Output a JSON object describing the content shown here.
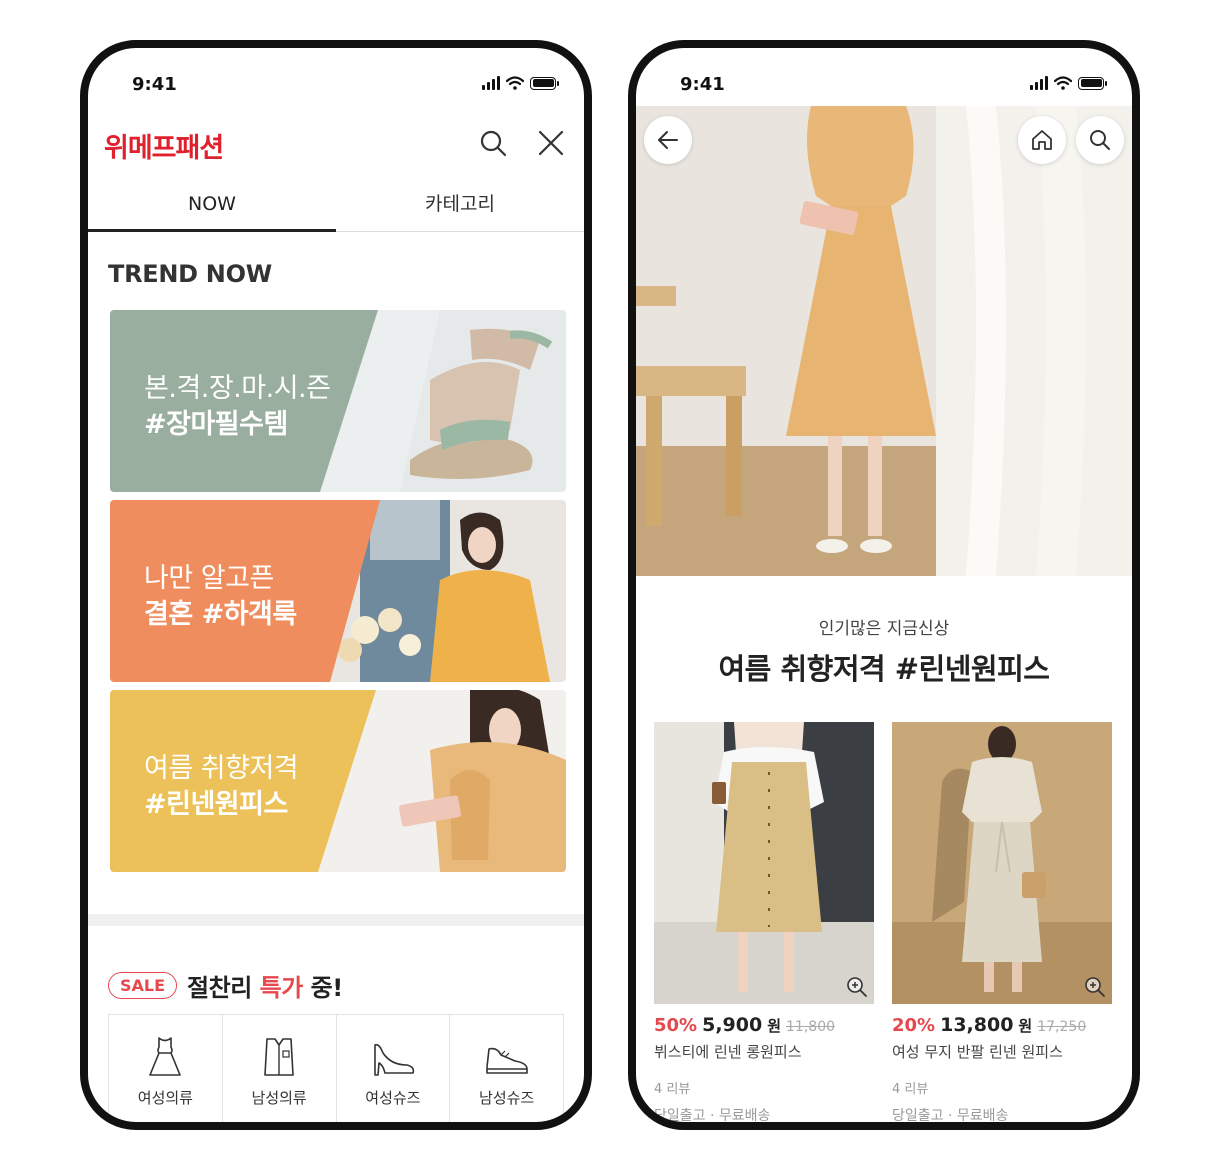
{
  "left": {
    "status_time": "9:41",
    "brand": "위메프패션",
    "tabs": [
      "NOW",
      "카테고리"
    ],
    "section_title": "TREND NOW",
    "banners": [
      {
        "line1": "본.격.장.마.시.즌",
        "line2": "#장마필수템",
        "color": "#9aae9f"
      },
      {
        "line1": "나만 알고픈",
        "line2": "결혼 #하객룩",
        "color": "#f08d5e"
      },
      {
        "line1": "여름 취향저격",
        "line2": "#린넨원피스",
        "color": "#ecc15a"
      }
    ],
    "sale_badge": "SALE",
    "sale_text_a": "절찬리 ",
    "sale_text_hl": "특가",
    "sale_text_b": " 중!",
    "categories": [
      {
        "label": "여성의류",
        "icon": "dress-icon"
      },
      {
        "label": "남성의류",
        "icon": "shirt-icon"
      },
      {
        "label": "여성슈즈",
        "icon": "heel-shoe-icon"
      },
      {
        "label": "남성슈즈",
        "icon": "sneaker-icon"
      }
    ]
  },
  "right": {
    "status_time": "9:41",
    "subtitle": "인기많은 지금신상",
    "title": "여름 취향저격 #린넨원피스",
    "products": [
      {
        "discount": "50%",
        "price": "5,900",
        "unit": "원",
        "original": "11,800",
        "name": "뷔스티에 린넨 롱원피스",
        "reviews": "4 리뷰",
        "shipping": "당일출고 · 무료배송"
      },
      {
        "discount": "20%",
        "price": "13,800",
        "unit": "원",
        "original": "17,250",
        "name": "여성 무지 반팔 린넨 원피스",
        "reviews": "4 리뷰",
        "shipping": "당일출고 · 무료배송"
      }
    ]
  }
}
